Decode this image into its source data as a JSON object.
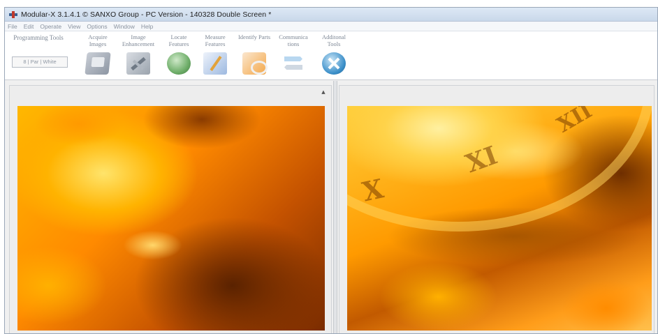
{
  "window": {
    "title": "Modular-X 3.1.4.1 © SANXO Group - PC Version - 140328 Double Screen *"
  },
  "menu": [
    "File",
    "Edit",
    "Operate",
    "View",
    "Options",
    "Window",
    "Help"
  ],
  "ribbon": {
    "programming_tools": {
      "label": "Programming Tools",
      "field_value": "8 | Par | White"
    },
    "tools": [
      {
        "label": "Acquire Images",
        "icon": "camera-icon"
      },
      {
        "label": "Image Enhancement",
        "icon": "enhance-tools-icon"
      },
      {
        "label": "Locate Features",
        "icon": "locate-globe-icon"
      },
      {
        "label": "Measure Features",
        "icon": "measure-ruler-icon"
      },
      {
        "label": "Identify Parts",
        "icon": "identify-glasses-icon"
      },
      {
        "label": "Communica tions",
        "icon": "communication-arrows-icon"
      },
      {
        "label": "Additonal Tools",
        "icon": "additional-tools-icon"
      }
    ]
  },
  "images": {
    "left": {
      "numerals": []
    },
    "right": {
      "numerals": [
        "X",
        "XI",
        "XII"
      ]
    }
  },
  "colors": {
    "titlebar": "#c9d8ea",
    "ribbon_text": "#7d8795",
    "background": "#f0f0f0"
  }
}
